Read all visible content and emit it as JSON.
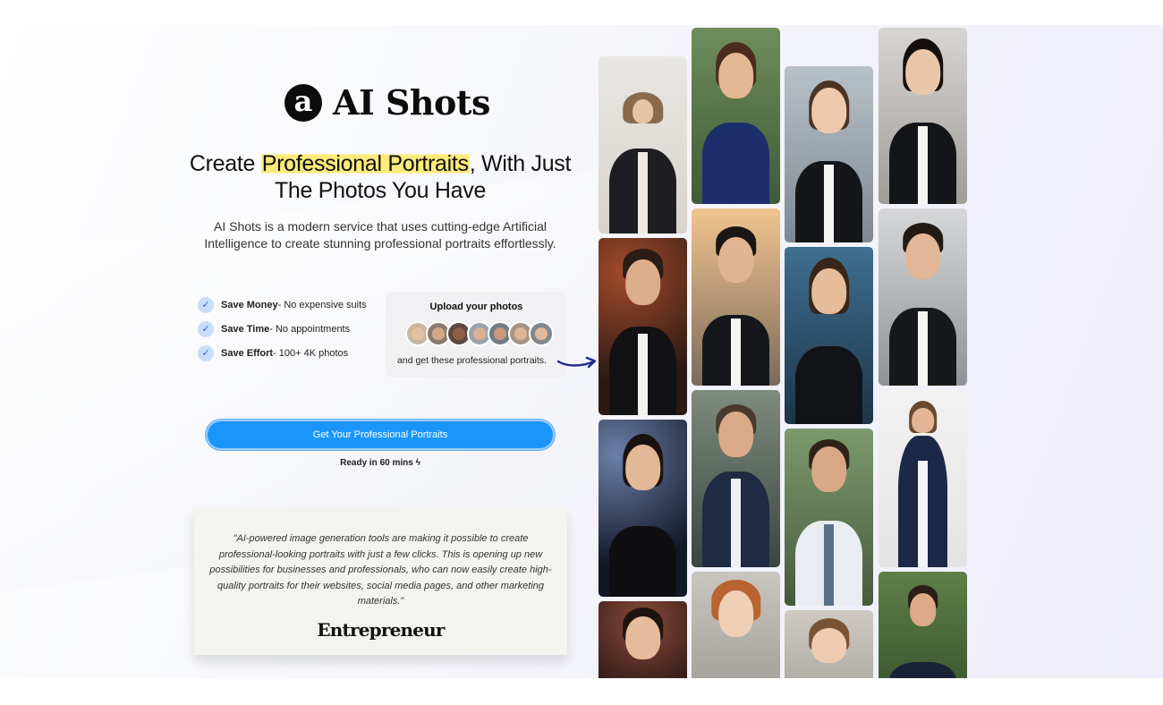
{
  "brand": {
    "logo_letter": "a",
    "name": "AI Shots"
  },
  "hero": {
    "headline_pre": "Create ",
    "headline_highlight": "Professional Portraits",
    "headline_post": ", With Just The Photos You Have",
    "description": "AI Shots is a modern service that uses cutting-edge Artificial Intelligence to create stunning professional portraits effortlessly."
  },
  "benefits": [
    {
      "title": "Save Money",
      "detail": " - No expensive suits"
    },
    {
      "title": "Save Time",
      "detail": " - No appointments"
    },
    {
      "title": "Save Effort",
      "detail": " - 100+ 4K photos"
    }
  ],
  "upload_card": {
    "title": "Upload your photos",
    "footer": "and get these professional portraits."
  },
  "cta": {
    "label": "Get Your Professional Portraits",
    "note": "Ready in 60 mins"
  },
  "quote": {
    "text": "\"AI-powered image generation tools are making it possible to create professional-looking portraits with just a few clicks. This is opening up new possibilities for businesses and professionals, who can now easily create high-quality portraits for their websites, social media pages, and other marketing materials.\"",
    "source": "Entrepreneur"
  },
  "colors": {
    "accent": "#1a96fb",
    "highlight": "#fbeb7a",
    "check_bg": "#c9ddfb"
  },
  "icons": {
    "check": "check-icon",
    "bolt": "lightning-icon",
    "arrow": "curved-arrow-icon"
  }
}
